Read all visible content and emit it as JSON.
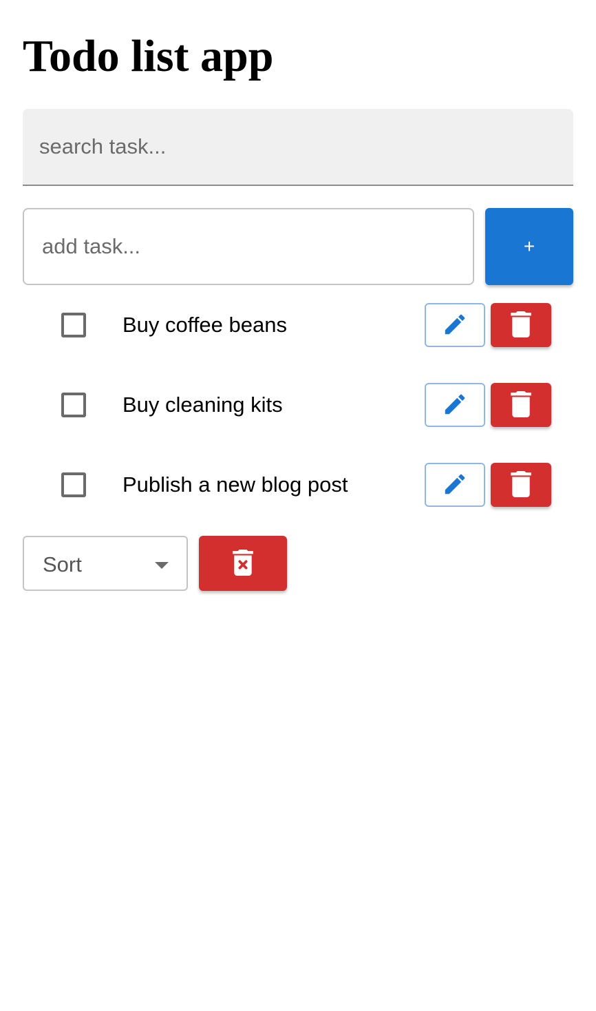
{
  "app": {
    "title": "Todo list app"
  },
  "search": {
    "placeholder": "search task...",
    "value": ""
  },
  "add": {
    "placeholder": "add task...",
    "value": "",
    "button_label": "+"
  },
  "tasks": [
    {
      "label": "Buy coffee beans",
      "done": false
    },
    {
      "label": "Buy cleaning kits",
      "done": false
    },
    {
      "label": "Publish a new blog post",
      "done": false
    }
  ],
  "actions": {
    "edit_icon": "pencil-icon",
    "delete_icon": "trash-icon",
    "clear_icon": "trash-x-icon"
  },
  "sort": {
    "selected": "Sort"
  },
  "colors": {
    "primary": "#1976d2",
    "danger": "#d32f2f"
  }
}
